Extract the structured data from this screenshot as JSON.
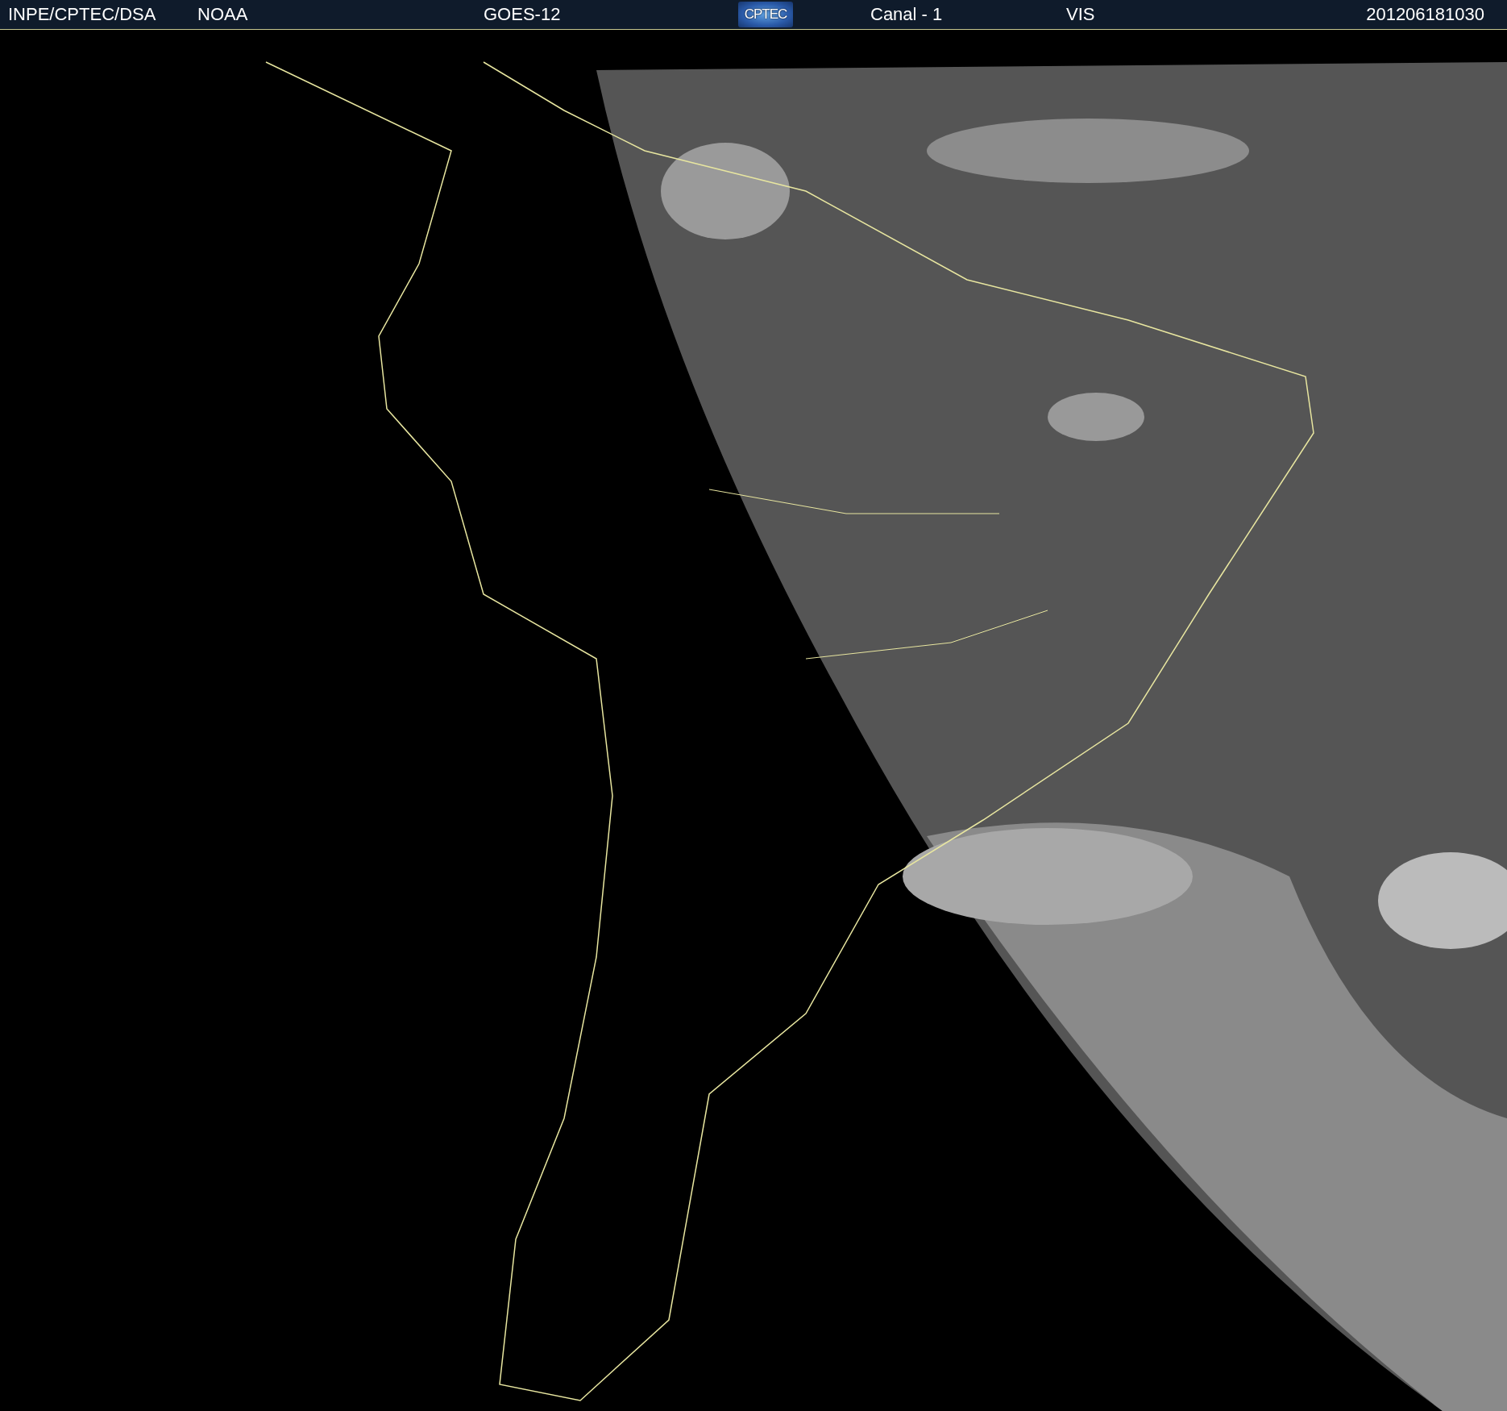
{
  "header": {
    "items": [
      {
        "kind": "text",
        "text": "INPE/CPTEC/DSA"
      },
      {
        "kind": "text",
        "text": "NOAA"
      },
      {
        "kind": "text",
        "text": "GOES-12"
      },
      {
        "kind": "logo",
        "text": "CPTEC"
      },
      {
        "kind": "text",
        "text": "Canal - 1"
      },
      {
        "kind": "text",
        "text": "VIS"
      },
      {
        "kind": "text",
        "text": "201206181030"
      }
    ]
  }
}
